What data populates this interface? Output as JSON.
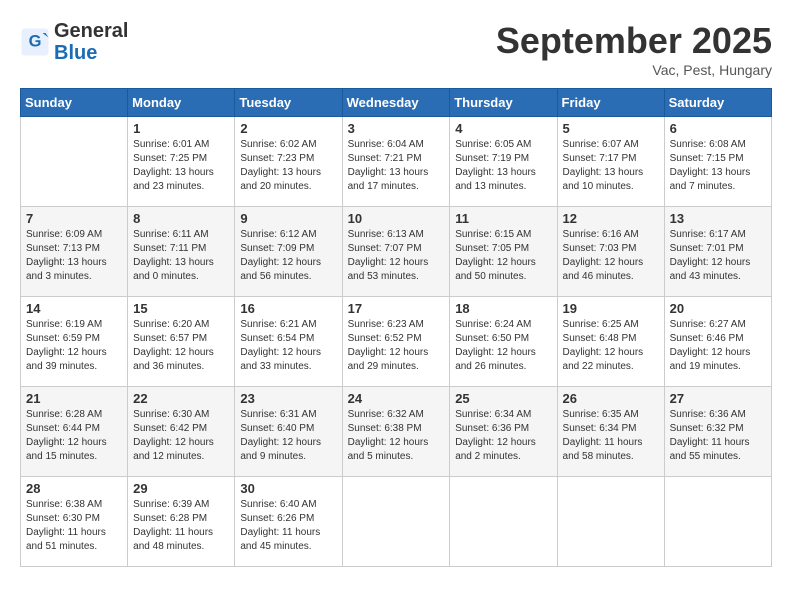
{
  "logo": {
    "general": "General",
    "blue": "Blue"
  },
  "title": "September 2025",
  "subtitle": "Vac, Pest, Hungary",
  "weekdays": [
    "Sunday",
    "Monday",
    "Tuesday",
    "Wednesday",
    "Thursday",
    "Friday",
    "Saturday"
  ],
  "weeks": [
    [
      {
        "day": "",
        "info": ""
      },
      {
        "day": "1",
        "info": "Sunrise: 6:01 AM\nSunset: 7:25 PM\nDaylight: 13 hours\nand 23 minutes."
      },
      {
        "day": "2",
        "info": "Sunrise: 6:02 AM\nSunset: 7:23 PM\nDaylight: 13 hours\nand 20 minutes."
      },
      {
        "day": "3",
        "info": "Sunrise: 6:04 AM\nSunset: 7:21 PM\nDaylight: 13 hours\nand 17 minutes."
      },
      {
        "day": "4",
        "info": "Sunrise: 6:05 AM\nSunset: 7:19 PM\nDaylight: 13 hours\nand 13 minutes."
      },
      {
        "day": "5",
        "info": "Sunrise: 6:07 AM\nSunset: 7:17 PM\nDaylight: 13 hours\nand 10 minutes."
      },
      {
        "day": "6",
        "info": "Sunrise: 6:08 AM\nSunset: 7:15 PM\nDaylight: 13 hours\nand 7 minutes."
      }
    ],
    [
      {
        "day": "7",
        "info": "Sunrise: 6:09 AM\nSunset: 7:13 PM\nDaylight: 13 hours\nand 3 minutes."
      },
      {
        "day": "8",
        "info": "Sunrise: 6:11 AM\nSunset: 7:11 PM\nDaylight: 13 hours\nand 0 minutes."
      },
      {
        "day": "9",
        "info": "Sunrise: 6:12 AM\nSunset: 7:09 PM\nDaylight: 12 hours\nand 56 minutes."
      },
      {
        "day": "10",
        "info": "Sunrise: 6:13 AM\nSunset: 7:07 PM\nDaylight: 12 hours\nand 53 minutes."
      },
      {
        "day": "11",
        "info": "Sunrise: 6:15 AM\nSunset: 7:05 PM\nDaylight: 12 hours\nand 50 minutes."
      },
      {
        "day": "12",
        "info": "Sunrise: 6:16 AM\nSunset: 7:03 PM\nDaylight: 12 hours\nand 46 minutes."
      },
      {
        "day": "13",
        "info": "Sunrise: 6:17 AM\nSunset: 7:01 PM\nDaylight: 12 hours\nand 43 minutes."
      }
    ],
    [
      {
        "day": "14",
        "info": "Sunrise: 6:19 AM\nSunset: 6:59 PM\nDaylight: 12 hours\nand 39 minutes."
      },
      {
        "day": "15",
        "info": "Sunrise: 6:20 AM\nSunset: 6:57 PM\nDaylight: 12 hours\nand 36 minutes."
      },
      {
        "day": "16",
        "info": "Sunrise: 6:21 AM\nSunset: 6:54 PM\nDaylight: 12 hours\nand 33 minutes."
      },
      {
        "day": "17",
        "info": "Sunrise: 6:23 AM\nSunset: 6:52 PM\nDaylight: 12 hours\nand 29 minutes."
      },
      {
        "day": "18",
        "info": "Sunrise: 6:24 AM\nSunset: 6:50 PM\nDaylight: 12 hours\nand 26 minutes."
      },
      {
        "day": "19",
        "info": "Sunrise: 6:25 AM\nSunset: 6:48 PM\nDaylight: 12 hours\nand 22 minutes."
      },
      {
        "day": "20",
        "info": "Sunrise: 6:27 AM\nSunset: 6:46 PM\nDaylight: 12 hours\nand 19 minutes."
      }
    ],
    [
      {
        "day": "21",
        "info": "Sunrise: 6:28 AM\nSunset: 6:44 PM\nDaylight: 12 hours\nand 15 minutes."
      },
      {
        "day": "22",
        "info": "Sunrise: 6:30 AM\nSunset: 6:42 PM\nDaylight: 12 hours\nand 12 minutes."
      },
      {
        "day": "23",
        "info": "Sunrise: 6:31 AM\nSunset: 6:40 PM\nDaylight: 12 hours\nand 9 minutes."
      },
      {
        "day": "24",
        "info": "Sunrise: 6:32 AM\nSunset: 6:38 PM\nDaylight: 12 hours\nand 5 minutes."
      },
      {
        "day": "25",
        "info": "Sunrise: 6:34 AM\nSunset: 6:36 PM\nDaylight: 12 hours\nand 2 minutes."
      },
      {
        "day": "26",
        "info": "Sunrise: 6:35 AM\nSunset: 6:34 PM\nDaylight: 11 hours\nand 58 minutes."
      },
      {
        "day": "27",
        "info": "Sunrise: 6:36 AM\nSunset: 6:32 PM\nDaylight: 11 hours\nand 55 minutes."
      }
    ],
    [
      {
        "day": "28",
        "info": "Sunrise: 6:38 AM\nSunset: 6:30 PM\nDaylight: 11 hours\nand 51 minutes."
      },
      {
        "day": "29",
        "info": "Sunrise: 6:39 AM\nSunset: 6:28 PM\nDaylight: 11 hours\nand 48 minutes."
      },
      {
        "day": "30",
        "info": "Sunrise: 6:40 AM\nSunset: 6:26 PM\nDaylight: 11 hours\nand 45 minutes."
      },
      {
        "day": "",
        "info": ""
      },
      {
        "day": "",
        "info": ""
      },
      {
        "day": "",
        "info": ""
      },
      {
        "day": "",
        "info": ""
      }
    ]
  ]
}
